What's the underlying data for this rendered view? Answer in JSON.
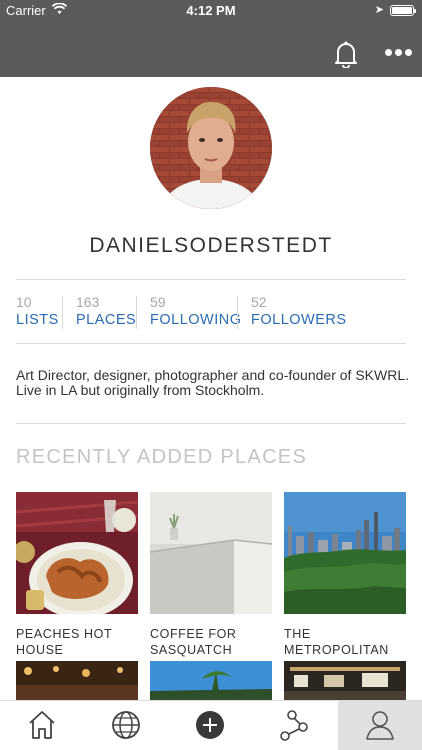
{
  "status_bar": {
    "carrier": "Carrier",
    "time": "4:12 PM"
  },
  "header": {
    "icons": [
      "bell-icon",
      "more-icon"
    ]
  },
  "profile": {
    "username": "DANIELSODERSTEDT",
    "bio": "Art Director, designer, photographer and co-founder of SKWRL. Live in LA but originally from Stockholm."
  },
  "stats": [
    {
      "count": "10",
      "label": "LISTS"
    },
    {
      "count": "163",
      "label": "PLACES"
    },
    {
      "count": "59",
      "label": "FOLLOWING"
    },
    {
      "count": "52",
      "label": "FOLLOWERS"
    }
  ],
  "recent": {
    "title": "RECENTLY ADDED PLACES",
    "places": [
      {
        "name": "PEACHES HOT HOUSE"
      },
      {
        "name": "COFFEE FOR SASQUATCH"
      },
      {
        "name": "THE METROPOLITAN MUSEUM OF ART"
      }
    ]
  },
  "tabbar": {
    "tabs": [
      "home",
      "explore",
      "add",
      "network",
      "profile"
    ],
    "active": "profile"
  },
  "colors": {
    "header": "#5b5b5b",
    "link": "#2a6bb3",
    "muted": "#a8a8a8"
  }
}
